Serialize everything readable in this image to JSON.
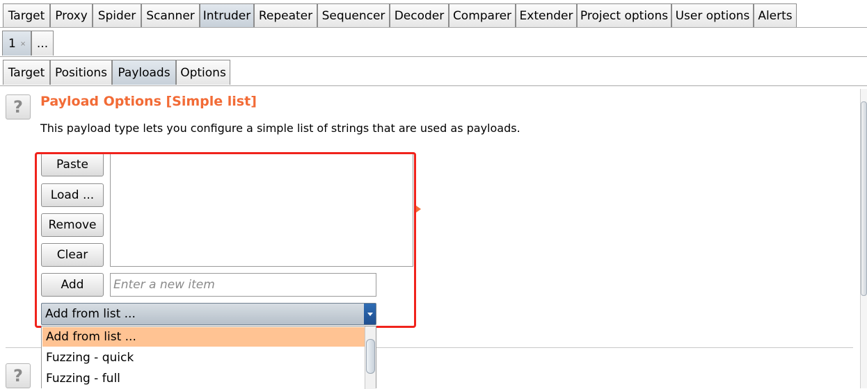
{
  "main_tabs": [
    {
      "label": "Target",
      "selected": false
    },
    {
      "label": "Proxy",
      "selected": false
    },
    {
      "label": "Spider",
      "selected": false
    },
    {
      "label": "Scanner",
      "selected": false
    },
    {
      "label": "Intruder",
      "selected": true
    },
    {
      "label": "Repeater",
      "selected": false
    },
    {
      "label": "Sequencer",
      "selected": false
    },
    {
      "label": "Decoder",
      "selected": false
    },
    {
      "label": "Comparer",
      "selected": false
    },
    {
      "label": "Extender",
      "selected": false
    },
    {
      "label": "Project options",
      "selected": false
    },
    {
      "label": "User options",
      "selected": false
    },
    {
      "label": "Alerts",
      "selected": false
    }
  ],
  "attack_tabs": [
    {
      "label": "1",
      "close": "×",
      "selected": true
    },
    {
      "label": "...",
      "selected": false
    }
  ],
  "sub_tabs": [
    {
      "label": "Target",
      "selected": false
    },
    {
      "label": "Positions",
      "selected": false
    },
    {
      "label": "Payloads",
      "selected": true
    },
    {
      "label": "Options",
      "selected": false
    }
  ],
  "payload_options": {
    "help_label": "?",
    "title": "Payload Options [Simple list]",
    "description": "This payload type lets you configure a simple list of strings that are used as payloads.",
    "buttons": {
      "paste": "Paste",
      "load": "Load ...",
      "remove": "Remove",
      "clear": "Clear",
      "add": "Add"
    },
    "new_item_placeholder": "Enter a new item",
    "combo_selected": "Add from list ...",
    "dropdown_options": [
      "Add from list ...",
      "Fuzzing - quick",
      "Fuzzing - full"
    ],
    "highlighted_option_index": 0
  },
  "next_section": {
    "help_label": "?"
  },
  "colors": {
    "title": "#f26b36",
    "highlight_border": "#f0231c",
    "selected_option": "#ffc393",
    "selected_tab": "#c7d0d9"
  }
}
